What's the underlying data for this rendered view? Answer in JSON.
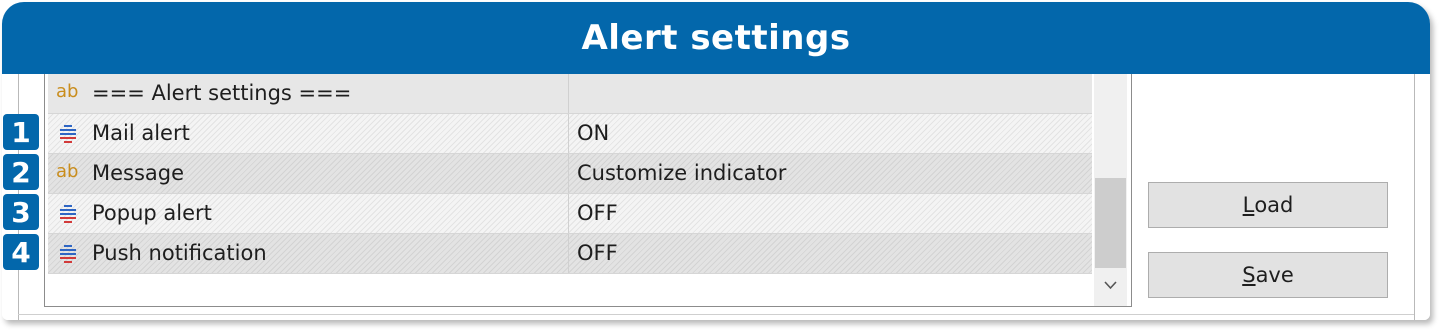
{
  "header": {
    "title": "Alert settings"
  },
  "rows": [
    {
      "badge": "",
      "icon": "ab-icon",
      "icon_text": "ab",
      "name": "=== Alert settings ===",
      "value": ""
    },
    {
      "badge": "1",
      "icon": "enum-list-icon",
      "name": "Mail alert",
      "value": "ON"
    },
    {
      "badge": "2",
      "icon": "ab-icon",
      "icon_text": "ab",
      "name": "Message",
      "value": "Customize indicator"
    },
    {
      "badge": "3",
      "icon": "enum-list-icon",
      "name": "Popup alert",
      "value": "OFF"
    },
    {
      "badge": "4",
      "icon": "enum-list-icon",
      "name": "Push notification",
      "value": "OFF"
    }
  ],
  "buttons": {
    "load": {
      "mnemonic": "L",
      "rest": "oad"
    },
    "save": {
      "mnemonic": "S",
      "rest": "ave"
    }
  },
  "colors": {
    "header_bg": "#0367ab",
    "badge_bg": "#0367ab",
    "ab_icon": "#c98d1d"
  }
}
